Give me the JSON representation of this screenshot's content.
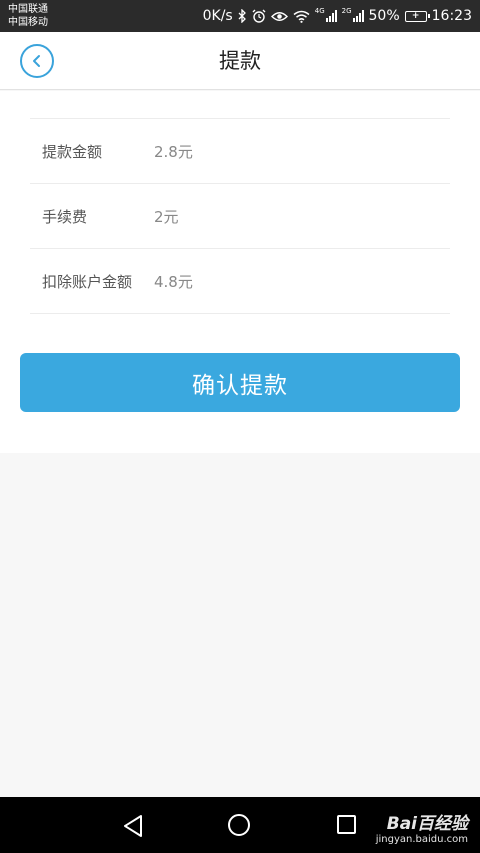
{
  "status_bar": {
    "carrier_1": "中国联通",
    "carrier_2": "中国移动",
    "network_speed": "0K/s",
    "signal_1_tag": "4G",
    "signal_2_tag": "2G",
    "battery_percent": "50%",
    "time": "16:23",
    "icons": [
      "bluetooth-icon",
      "alarm-icon",
      "eye-icon",
      "wifi-icon",
      "signal-icon",
      "battery-icon"
    ]
  },
  "header": {
    "title": "提款",
    "back_icon": "chevron-left-icon"
  },
  "details": [
    {
      "label": "提款金额",
      "value": "2.8元"
    },
    {
      "label": "手续费",
      "value": "2元"
    },
    {
      "label": "扣除账户金额",
      "value": "4.8元"
    }
  ],
  "actions": {
    "confirm_label": "确认提款"
  },
  "colors": {
    "accent": "#3aa8df",
    "status_bar": "#2b2b2b",
    "page_background": "#f7f7f7"
  },
  "watermark": {
    "brand": "Bai百经验",
    "url": "jingyan.baidu.com"
  }
}
